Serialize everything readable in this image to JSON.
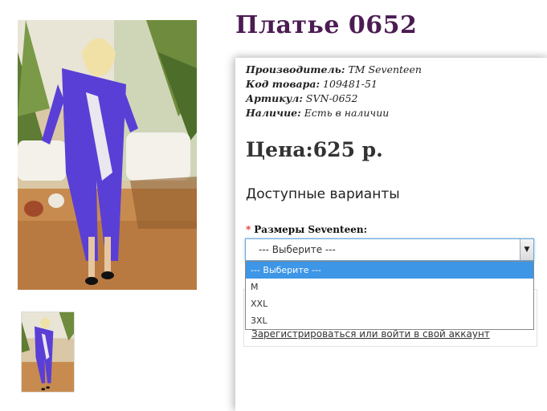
{
  "product": {
    "title": "Платье 0652",
    "info": [
      {
        "key": "Производитель:",
        "value": " TM Seventeen"
      },
      {
        "key": "Код товара:",
        "value": " 109481-51"
      },
      {
        "key": "Артикул:",
        "value": " SVN-0652"
      },
      {
        "key": "Наличие:",
        "value": " Есть в наличии"
      }
    ],
    "price": "Цена:625 р."
  },
  "options": {
    "heading": "Доступные варианты",
    "required_mark": "*",
    "size_label": "Размеры Seventeen:",
    "selected": "--- Выберите ---",
    "dropdown_items": [
      "--- Выберите ---",
      "M",
      "XXL",
      "3XL"
    ]
  },
  "account": {
    "login_link": "Зарегистрироваться или войти в свой аккаунт"
  },
  "colors": {
    "title": "#4b1c52",
    "dress": "#5a3fd6",
    "dropdown_highlight": "#3d96e6",
    "required": "#e0342a"
  },
  "icons": {
    "dropdown_arrow": "triangle-down"
  }
}
